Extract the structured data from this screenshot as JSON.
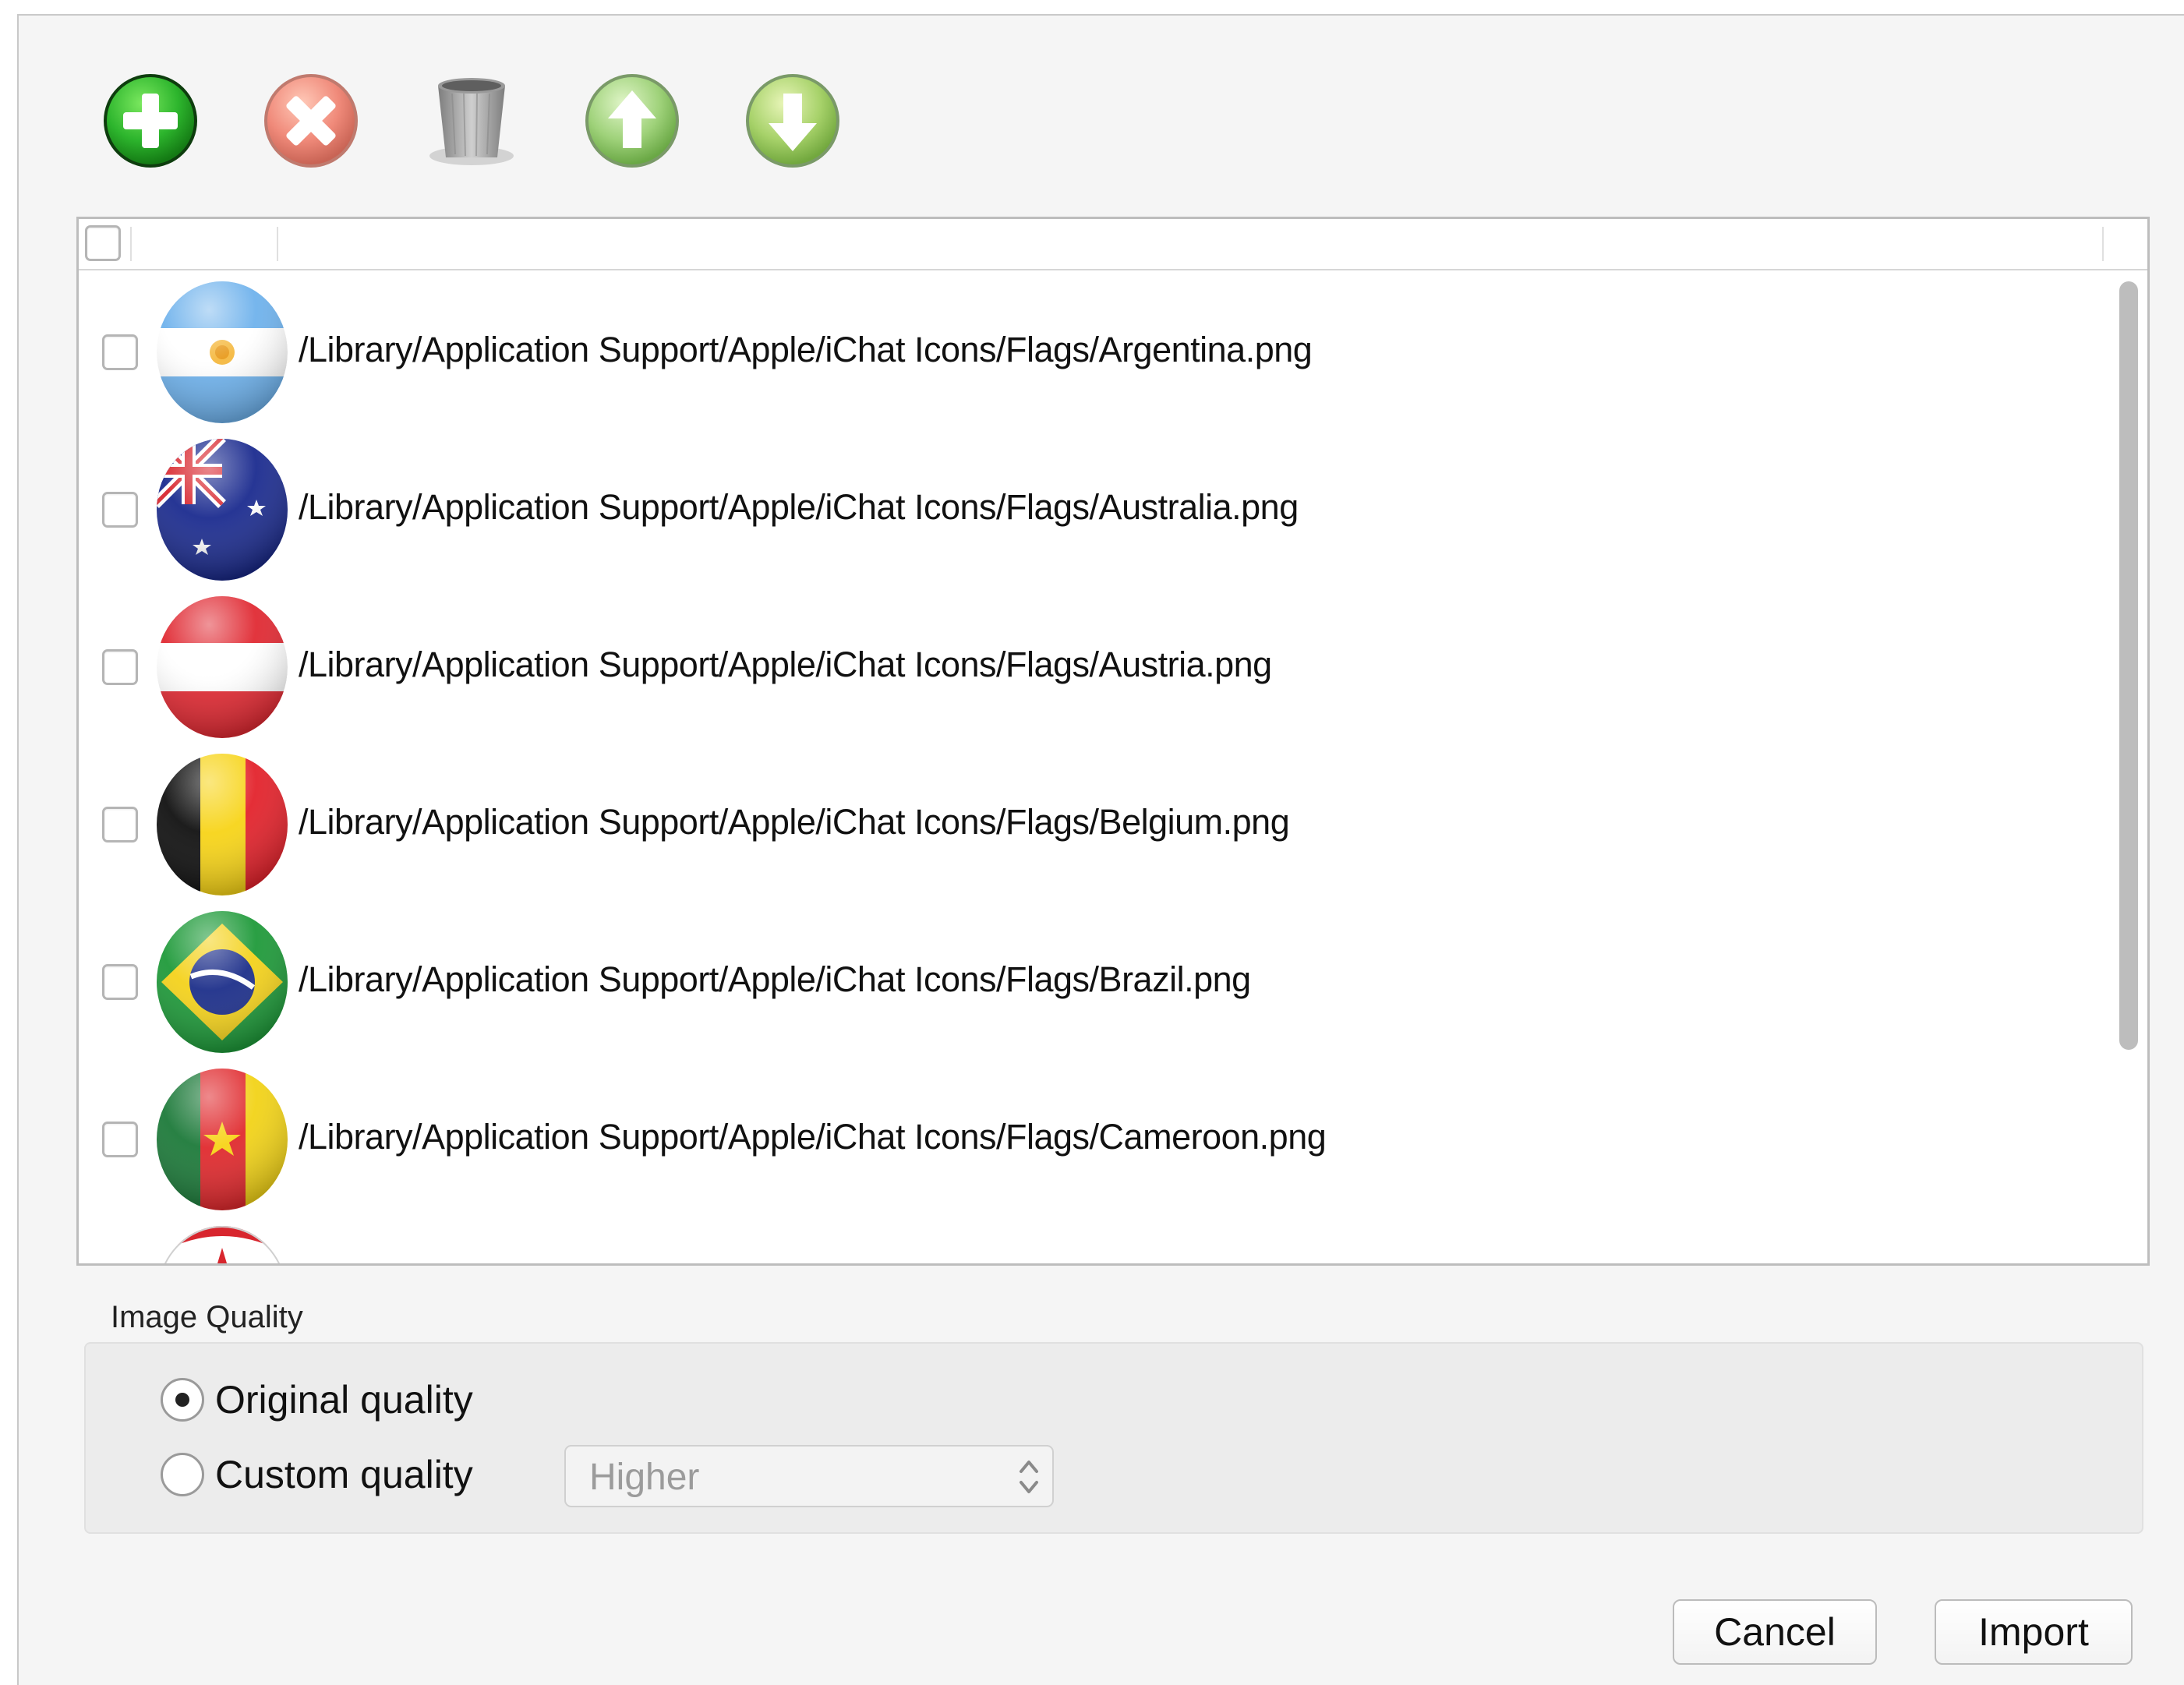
{
  "toolbar": {
    "buttons": [
      {
        "name": "add-icon",
        "color": "#2db52d"
      },
      {
        "name": "remove-icon",
        "color": "#f08a7a"
      },
      {
        "name": "trash-icon",
        "color": "#9a9a9a"
      },
      {
        "name": "arrow-up-icon",
        "color": "#9fd27a"
      },
      {
        "name": "arrow-down-icon",
        "color": "#9fd27a"
      }
    ]
  },
  "file_list": {
    "rows": [
      {
        "path": "/Library/Application Support/Apple/iChat Icons/Flags/Argentina.png",
        "flag": "argentina-flag-icon"
      },
      {
        "path": "/Library/Application Support/Apple/iChat Icons/Flags/Australia.png",
        "flag": "australia-flag-icon"
      },
      {
        "path": "/Library/Application Support/Apple/iChat Icons/Flags/Austria.png",
        "flag": "austria-flag-icon"
      },
      {
        "path": "/Library/Application Support/Apple/iChat Icons/Flags/Belgium.png",
        "flag": "belgium-flag-icon"
      },
      {
        "path": "/Library/Application Support/Apple/iChat Icons/Flags/Brazil.png",
        "flag": "brazil-flag-icon"
      },
      {
        "path": "/Library/Application Support/Apple/iChat Icons/Flags/Cameroon.png",
        "flag": "cameroon-flag-icon"
      }
    ]
  },
  "image_quality": {
    "label": "Image Quality",
    "original_label": "Original quality",
    "custom_label": "Custom quality",
    "selected": "original",
    "custom_select_value": "Higher"
  },
  "buttons": {
    "cancel_label": "Cancel",
    "import_label": "Import"
  }
}
